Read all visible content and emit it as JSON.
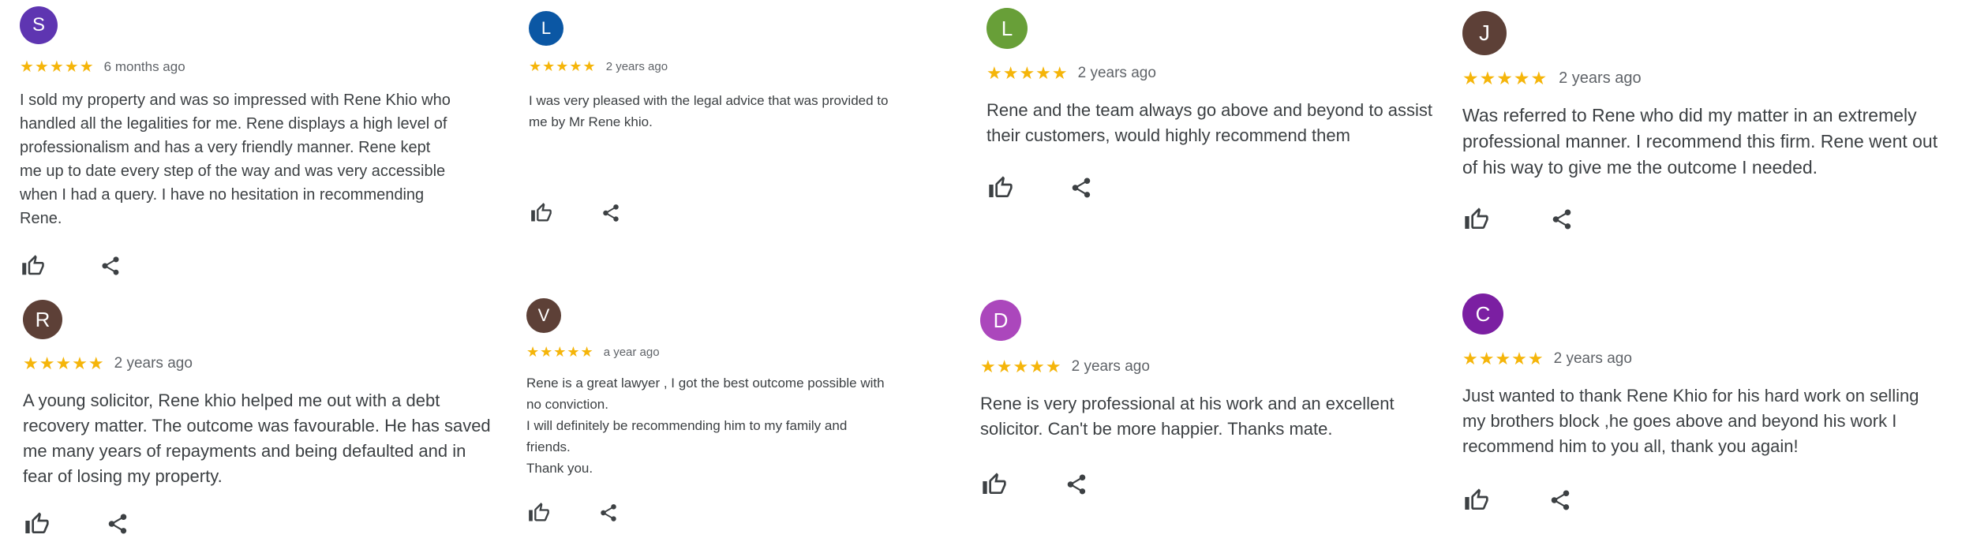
{
  "reviews": [
    {
      "initial": "S",
      "color": "#5e35b1",
      "stars": "★★★★★",
      "time": "6 months ago",
      "text": "I sold my property and was so impressed with Rene Khio who\nhandled all the legalities for me. Rene displays a high level of\nprofessionalism and has a very friendly manner. Rene kept\nme up to date every step of the way and was very accessible\nwhen I had a query. I have no hesitation in recommending\nRene."
    },
    {
      "initial": "L",
      "color": "#0b57a4",
      "stars": "★★★★★",
      "time": "2 years ago",
      "text": "I was very pleased with the legal advice that was provided to\nme by Mr Rene khio."
    },
    {
      "initial": "L",
      "color": "#689f38",
      "stars": "★★★★★",
      "time": "2 years ago",
      "text": "Rene and the team always go above and beyond to assist\ntheir customers, would highly recommend them"
    },
    {
      "initial": "J",
      "color": "#5d4037",
      "stars": "★★★★★",
      "time": "2 years ago",
      "text": "Was referred to Rene who did my matter in an extremely\nprofessional manner. I recommend this firm. Rene went out\nof his way to give me the outcome I needed."
    },
    {
      "initial": "R",
      "color": "#5d4037",
      "stars": "★★★★★",
      "time": "2 years ago",
      "text": "A young solicitor, Rene khio helped me out with a debt\nrecovery matter. The outcome was favourable. He has saved\nme many years of repayments and being defaulted and in\nfear of losing my property."
    },
    {
      "initial": "V",
      "color": "#5d4037",
      "stars": "★★★★★",
      "time": "a year ago",
      "text": "Rene is a great lawyer , I got the best outcome possible with\nno conviction.\nI will definitely be recommending him to my family and\nfriends.\nThank you."
    },
    {
      "initial": "D",
      "color": "#ab47bc",
      "stars": "★★★★★",
      "time": "2 years ago",
      "text": "Rene is very professional at his work and an excellent\nsolicitor. Can't be more happier. Thanks mate."
    },
    {
      "initial": "C",
      "color": "#7b1fa2",
      "stars": "★★★★★",
      "time": "2 years ago",
      "text": "Just wanted to thank Rene Khio for his hard work on selling\nmy brothers block ,he goes above and beyond his work I\nrecommend him to you all, thank you again!"
    }
  ]
}
